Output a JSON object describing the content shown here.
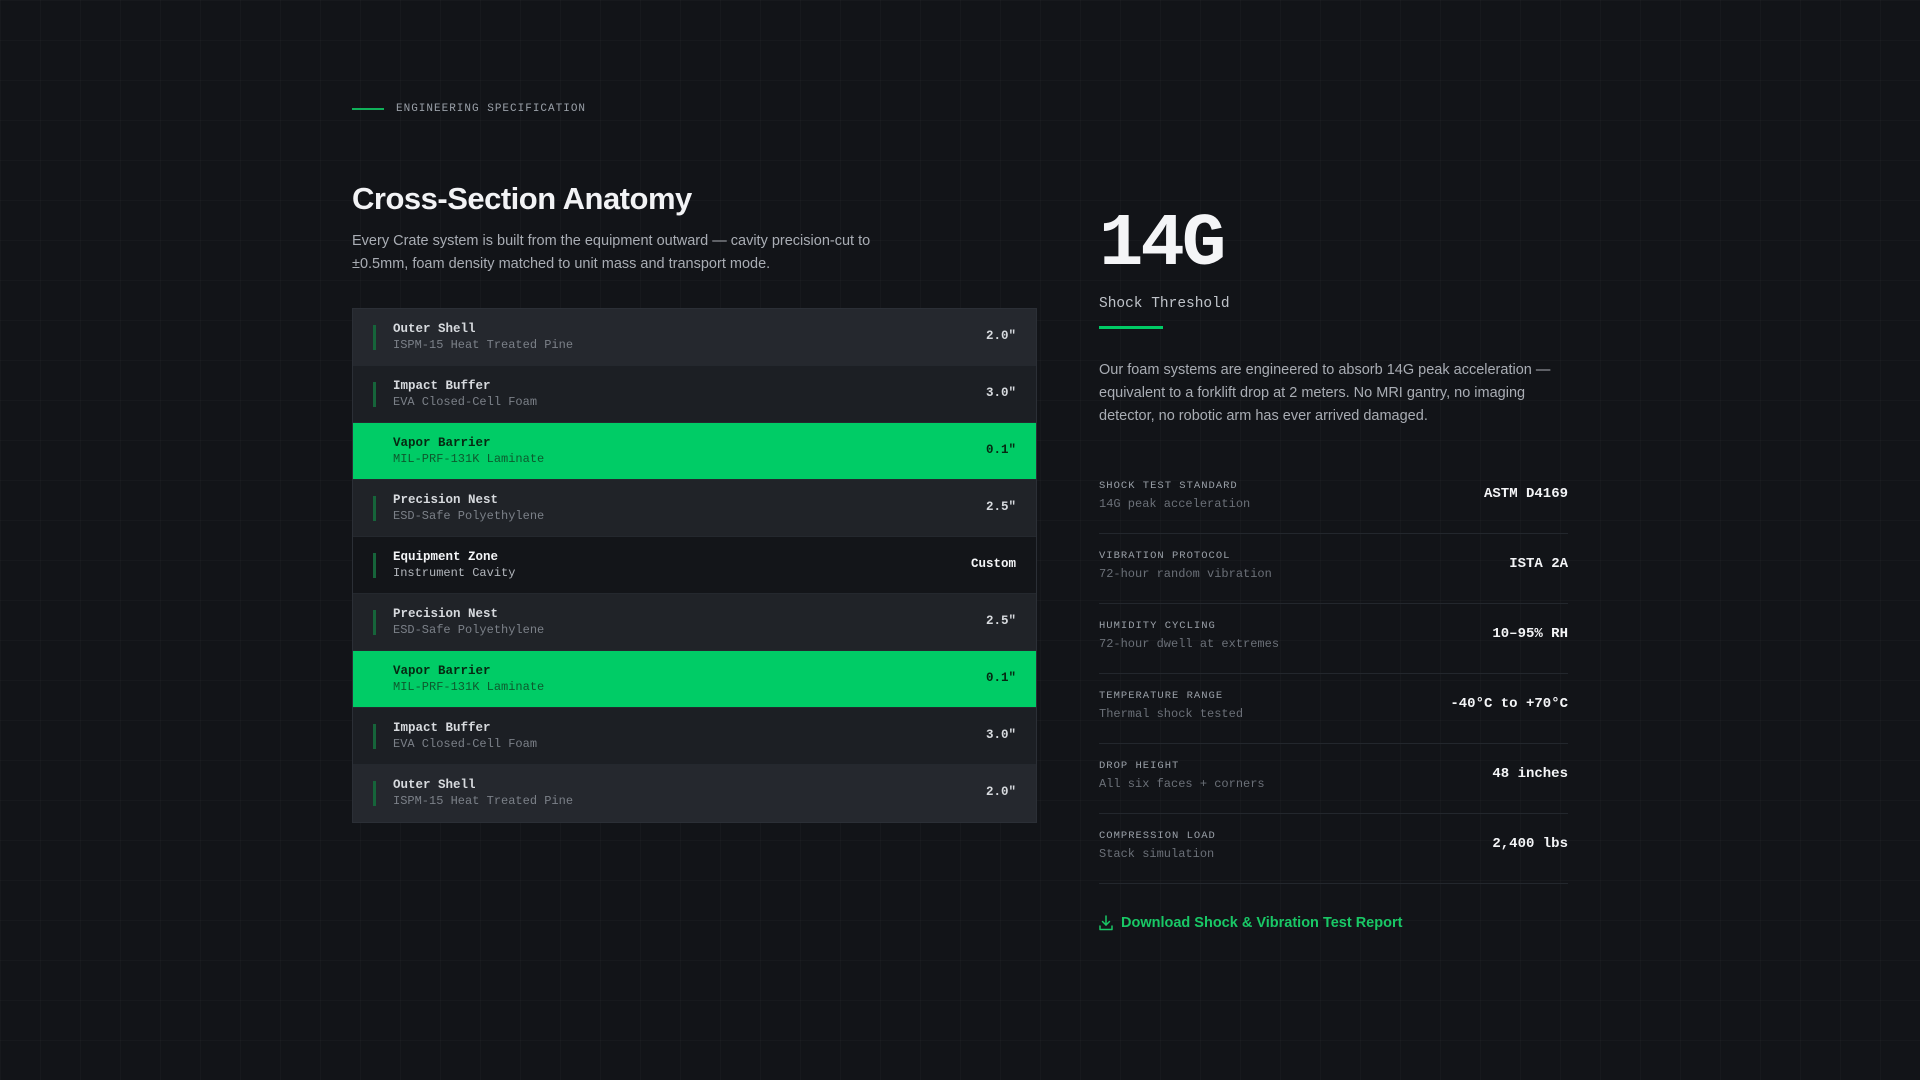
{
  "eyebrow": "ENGINEERING SPECIFICATION",
  "section": {
    "title": "Cross-Section Anatomy",
    "intro": "Every Crate system is built from the equipment outward — cavity precision-cut to ±0.5mm, foam density matched to unit mass and transport mode."
  },
  "layers": [
    {
      "name": "Outer Shell",
      "material": "ISPM-15 Heat Treated Pine",
      "thickness": "2.0\""
    },
    {
      "name": "Impact Buffer",
      "material": "EVA Closed-Cell Foam",
      "thickness": "3.0\""
    },
    {
      "name": "Vapor Barrier",
      "material": "MIL-PRF-131K Laminate",
      "thickness": "0.1\""
    },
    {
      "name": "Precision Nest",
      "material": "ESD-Safe Polyethylene",
      "thickness": "2.5\""
    },
    {
      "name": "Equipment Zone",
      "material": "Instrument Cavity",
      "thickness": "Custom"
    },
    {
      "name": "Precision Nest",
      "material": "ESD-Safe Polyethylene",
      "thickness": "2.5\""
    },
    {
      "name": "Vapor Barrier",
      "material": "MIL-PRF-131K Laminate",
      "thickness": "0.1\""
    },
    {
      "name": "Impact Buffer",
      "material": "EVA Closed-Cell Foam",
      "thickness": "3.0\""
    },
    {
      "name": "Outer Shell",
      "material": "ISPM-15 Heat Treated Pine",
      "thickness": "2.0\""
    }
  ],
  "stat": {
    "value": "14G",
    "label": "Shock Threshold",
    "description": "Our foam systems are engineered to absorb 14G peak acceleration — equivalent to a forklift drop at 2 meters. No MRI gantry, no imaging detector, no robotic arm has ever arrived damaged."
  },
  "specs": [
    {
      "label": "SHOCK TEST STANDARD",
      "sub": "14G peak acceleration",
      "value": "ASTM D4169"
    },
    {
      "label": "VIBRATION PROTOCOL",
      "sub": "72-hour random vibration",
      "value": "ISTA 2A"
    },
    {
      "label": "HUMIDITY CYCLING",
      "sub": "72-hour dwell at extremes",
      "value": "10–95% RH"
    },
    {
      "label": "TEMPERATURE RANGE",
      "sub": "Thermal shock tested",
      "value": "-40°C to +70°C"
    },
    {
      "label": "DROP HEIGHT",
      "sub": "All six faces + corners",
      "value": "48 inches"
    },
    {
      "label": "COMPRESSION LOAD",
      "sub": "Stack simulation",
      "value": "2,400 lbs"
    }
  ],
  "download": {
    "label": "Download Shock & Vibration Test Report",
    "icon": "download-icon"
  },
  "colors": {
    "accent": "#00cc66",
    "background": "#121418"
  }
}
